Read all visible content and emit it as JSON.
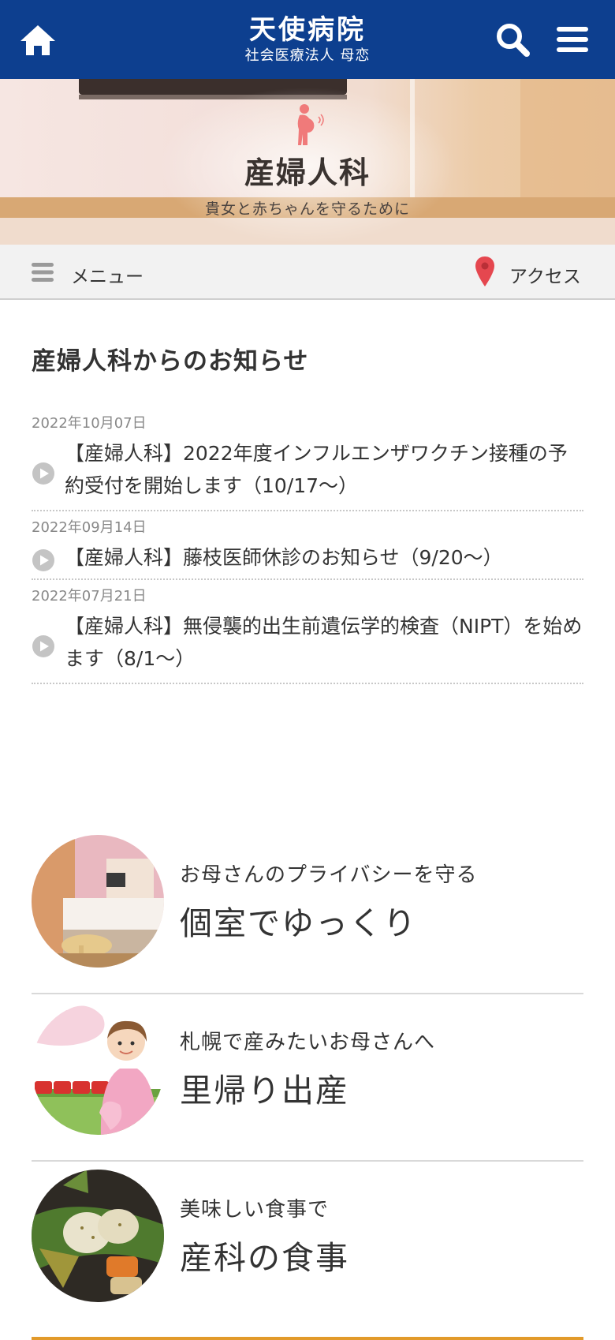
{
  "header": {
    "brand_name": "天使病院",
    "brand_sub": "社会医療法人 母恋"
  },
  "hero": {
    "title": "産婦人科",
    "subtitle": "貴女と赤ちゃんを守るために"
  },
  "subnav": {
    "menu_label": "メニュー",
    "access_label": "アクセス"
  },
  "news": {
    "heading": "産婦人科からのお知らせ",
    "items": [
      {
        "date": "2022年10月07日",
        "title": "【産婦人科】2022年度インフルエンザワクチン接種の予約受付を開始します（10/17～）"
      },
      {
        "date": "2022年09月14日",
        "title": "【産婦人科】藤枝医師休診のお知らせ（9/20～）"
      },
      {
        "date": "2022年07月21日",
        "title": "【産婦人科】無侵襲的出生前遺伝学的検査（NIPT）を始めます（8/1～）"
      }
    ]
  },
  "features": [
    {
      "pre": "お母さんのプライバシーを守る",
      "main": "個室でゆっくり"
    },
    {
      "pre": "札幌で産みたいお母さんへ",
      "main": "里帰り出産"
    },
    {
      "pre": "美味しい食事で",
      "main": "産科の食事"
    }
  ],
  "colors": {
    "header_bg": "#0d3f8f",
    "accent_orange": "#e29a2a",
    "pin_red": "#e5474f",
    "pregnant_icon": "#f07a7a"
  }
}
